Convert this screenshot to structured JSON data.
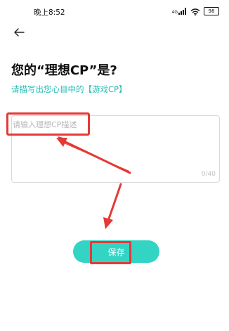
{
  "status_bar": {
    "time": "晚上8:52",
    "signal_text": "4G",
    "battery_level": "98"
  },
  "header": {
    "back_icon": "arrow-left-icon"
  },
  "main": {
    "title": "您的“理想CP”是?",
    "subtitle": "请描写出您心目中的【游戏CP】",
    "input": {
      "placeholder": "请输入理想CP描述",
      "value": "",
      "counter": "0/40"
    },
    "save_label": "保存"
  },
  "colors": {
    "accent": "#34d4c4",
    "subtitle": "#22bdb0",
    "annotation": "#e53935"
  }
}
